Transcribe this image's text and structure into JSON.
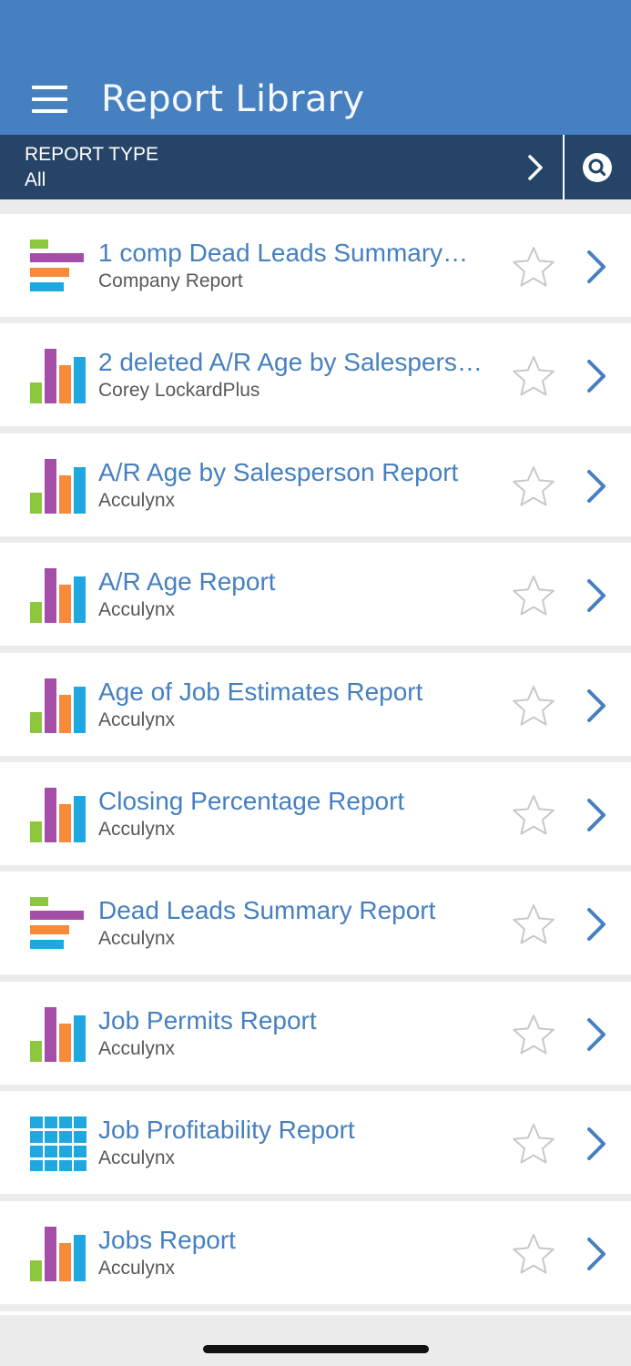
{
  "header": {
    "title": "Report Library",
    "menu_icon": "hamburger-menu-icon",
    "background_color": "#4680c0"
  },
  "filter": {
    "label": "REPORT TYPE",
    "value": "All",
    "chevron_icon": "chevron-right-icon",
    "search_icon": "search-icon",
    "background_color": "#254468"
  },
  "colors": {
    "link": "#4680c0",
    "subtitle": "#595959",
    "icon_purple": "#a54ea8",
    "icon_orange": "#f68b3c",
    "icon_green": "#8dc63f",
    "icon_blue": "#1fa8e0",
    "star_outline": "#c8c8c8"
  },
  "reports": [
    {
      "title": "1 comp Dead Leads Summary…",
      "subtitle": "Company Report",
      "icon": "horizontal-bar-chart-icon",
      "favorite": false
    },
    {
      "title": "2 deleted A/R Age by Salespers…",
      "subtitle": "Corey LockardPlus",
      "icon": "bar-chart-icon",
      "favorite": false
    },
    {
      "title": "A/R Age by Salesperson Report",
      "subtitle": "Acculynx",
      "icon": "bar-chart-icon",
      "favorite": false
    },
    {
      "title": "A/R Age Report",
      "subtitle": "Acculynx",
      "icon": "bar-chart-icon",
      "favorite": false
    },
    {
      "title": "Age of Job Estimates Report",
      "subtitle": "Acculynx",
      "icon": "bar-chart-icon",
      "favorite": false
    },
    {
      "title": "Closing Percentage Report",
      "subtitle": "Acculynx",
      "icon": "bar-chart-icon",
      "favorite": false
    },
    {
      "title": "Dead Leads Summary Report",
      "subtitle": "Acculynx",
      "icon": "horizontal-bar-chart-icon",
      "favorite": false
    },
    {
      "title": "Job Permits Report",
      "subtitle": "Acculynx",
      "icon": "bar-chart-icon",
      "favorite": false
    },
    {
      "title": "Job Profitability Report",
      "subtitle": "Acculynx",
      "icon": "table-grid-icon",
      "favorite": false
    },
    {
      "title": "Jobs Report",
      "subtitle": "Acculynx",
      "icon": "bar-chart-icon",
      "favorite": false
    }
  ]
}
